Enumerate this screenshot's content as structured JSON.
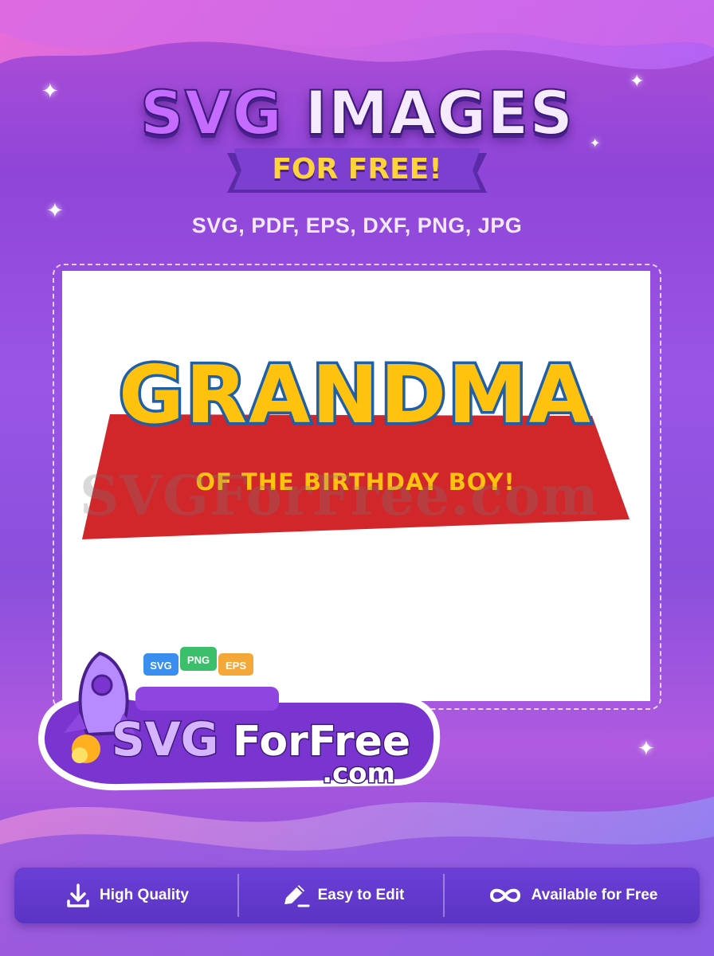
{
  "header": {
    "title_part1": "SVG",
    "title_part2": "IMAGES",
    "subtitle": "FOR FREE!",
    "formats": "SVG, PDF, EPS, DXF, PNG, JPG"
  },
  "design": {
    "main_word": "GRANDMA",
    "tagline": "OF THE BIRTHDAY BOY!",
    "watermark": "SVGForFree.com",
    "colors": {
      "letters": "#ffc20e",
      "outline": "#1f5fa8",
      "banner": "#d1272b"
    }
  },
  "logo": {
    "name_part1": "SVG",
    "name_part2": "ForFree",
    "domain": ".com",
    "badges": [
      "SVG",
      "PNG",
      "EPS"
    ]
  },
  "features": [
    {
      "label": "High Quality",
      "icon": "download-icon"
    },
    {
      "label": "Easy to Edit",
      "icon": "pencil-icon"
    },
    {
      "label": "Available for Free",
      "icon": "infinity-icon"
    }
  ]
}
